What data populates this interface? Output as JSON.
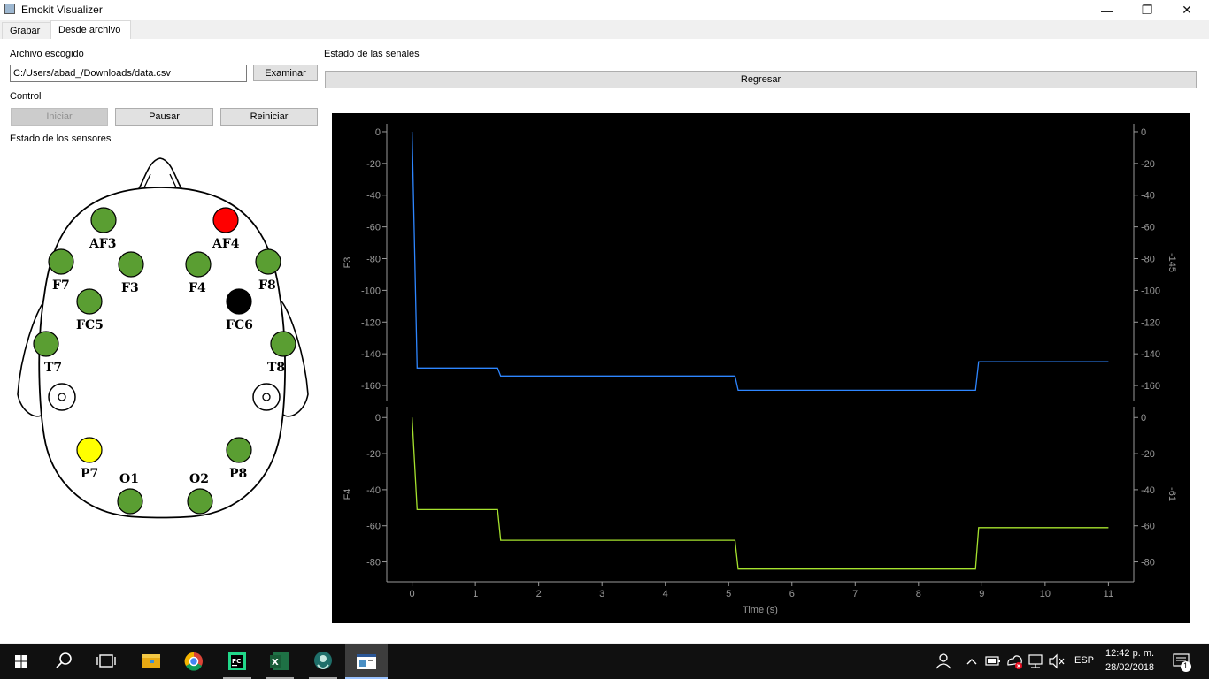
{
  "window": {
    "title": "Emokit Visualizer",
    "minimize": "—",
    "maximize": "❐",
    "close": "✕"
  },
  "tabs": [
    {
      "label": "Grabar"
    },
    {
      "label": "Desde archivo"
    }
  ],
  "left": {
    "file_label": "Archivo escogido",
    "file_path": "C:/Users/abad_/Downloads/data.csv",
    "browse_button": "Examinar",
    "control_label": "Control",
    "start_button": "Iniciar",
    "pause_button": "Pausar",
    "restart_button": "Reiniciar",
    "sensors_label": "Estado de los sensores"
  },
  "sensors": [
    {
      "name": "AF3",
      "color": "#5a9e32"
    },
    {
      "name": "AF4",
      "color": "#ff0000"
    },
    {
      "name": "F7",
      "color": "#5a9e32"
    },
    {
      "name": "F3",
      "color": "#5a9e32"
    },
    {
      "name": "F4",
      "color": "#5a9e32"
    },
    {
      "name": "F8",
      "color": "#5a9e32"
    },
    {
      "name": "FC5",
      "color": "#5a9e32"
    },
    {
      "name": "FC6",
      "color": "#000000"
    },
    {
      "name": "T7",
      "color": "#5a9e32"
    },
    {
      "name": "T8",
      "color": "#5a9e32"
    },
    {
      "name": "P7",
      "color": "#ffff00"
    },
    {
      "name": "P8",
      "color": "#5a9e32"
    },
    {
      "name": "O1",
      "color": "#5a9e32"
    },
    {
      "name": "O2",
      "color": "#5a9e32"
    }
  ],
  "right": {
    "signals_label": "Estado de las senales",
    "back_button": "Regresar"
  },
  "chart_data": [
    {
      "type": "line",
      "ylabel": "F3",
      "right_label": "-145",
      "color": "#2e86ff",
      "ylim": [
        -170,
        5
      ],
      "yticks": [
        0,
        -20,
        -40,
        -60,
        -80,
        -100,
        -120,
        -140,
        -160
      ],
      "xlim": [
        -0.4,
        11.4
      ],
      "x": [
        0,
        0.08,
        1.35,
        1.4,
        5.1,
        5.15,
        8.9,
        8.95,
        11
      ],
      "y": [
        0,
        -149,
        -149,
        -154,
        -154,
        -163,
        -163,
        -145,
        -145
      ]
    },
    {
      "type": "line",
      "ylabel": "F4",
      "right_label": "-61",
      "color": "#a6e22e",
      "xlabel": "Time (s)",
      "ylim": [
        -91,
        6
      ],
      "yticks": [
        0,
        -20,
        -40,
        -60,
        -80
      ],
      "xlim": [
        -0.4,
        11.4
      ],
      "xticks": [
        0,
        1,
        2,
        3,
        4,
        5,
        6,
        7,
        8,
        9,
        10,
        11
      ],
      "x": [
        0,
        0.08,
        1.35,
        1.4,
        5.1,
        5.15,
        8.9,
        8.95,
        11
      ],
      "y": [
        0,
        -51,
        -51,
        -68,
        -68,
        -84,
        -84,
        -61,
        -61
      ]
    }
  ],
  "taskbar": {
    "language": "ESP",
    "time": "12:42 p. m.",
    "date": "28/02/2018",
    "notification_count": "1"
  }
}
